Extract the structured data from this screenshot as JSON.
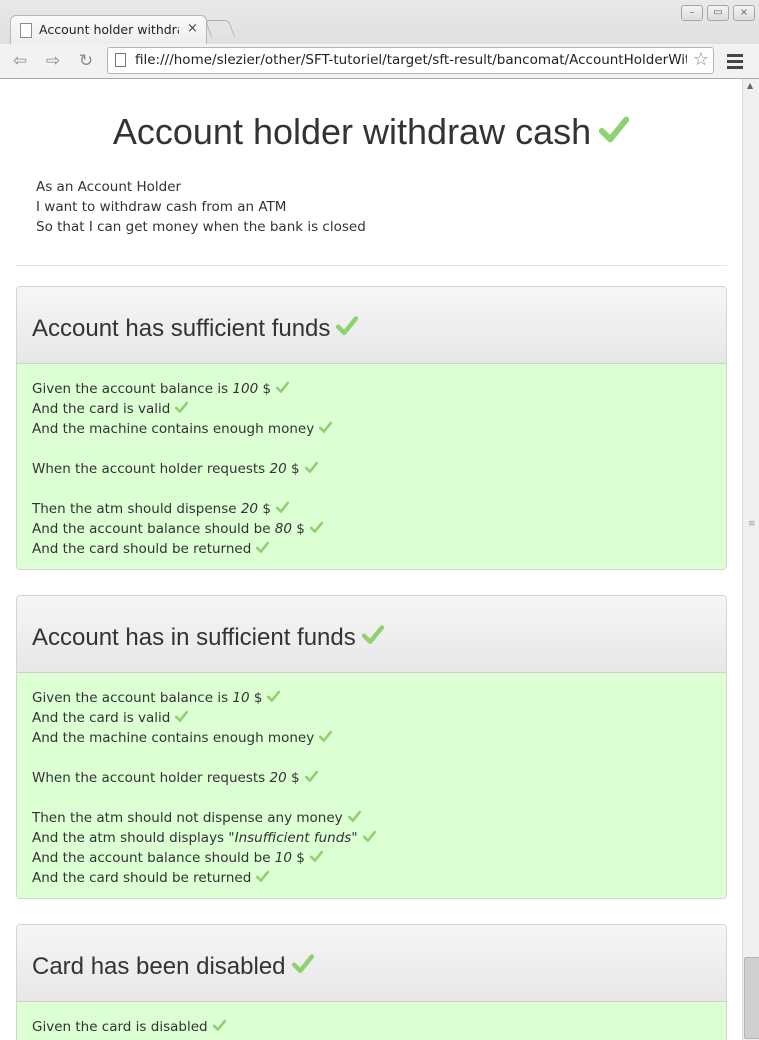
{
  "browser": {
    "tab_title": "Account holder withdraw",
    "tab_close": "×",
    "url": "file:///home/slezier/other/SFT-tutoriel/target/sft-result/bancomat/AccountHolderWithdrawCash.html",
    "window_minimize": "–",
    "window_maximize": "▭",
    "window_close": "×"
  },
  "feature": {
    "title": "Account holder withdraw cash",
    "story": [
      "As an Account Holder",
      "I want to withdraw cash from an ATM",
      "So that I can get money when the bank is closed"
    ]
  },
  "scenarios": [
    {
      "title": "Account has sufficient funds",
      "steps": [
        {
          "before": "Given the account balance is ",
          "param": "100",
          "after": " $"
        },
        {
          "before": "And the card is valid",
          "param": "",
          "after": ""
        },
        {
          "before": "And the machine contains enough money",
          "param": "",
          "after": ""
        },
        {
          "before": "When the account holder requests ",
          "param": "20",
          "after": " $"
        },
        {
          "before": "Then the atm should dispense ",
          "param": "20",
          "after": " $"
        },
        {
          "before": "And the account balance should be ",
          "param": "80",
          "after": " $"
        },
        {
          "before": "And the card should be returned",
          "param": "",
          "after": ""
        }
      ]
    },
    {
      "title": "Account has in sufficient funds",
      "steps": [
        {
          "before": "Given the account balance is ",
          "param": "10",
          "after": " $"
        },
        {
          "before": "And the card is valid",
          "param": "",
          "after": ""
        },
        {
          "before": "And the machine contains enough money",
          "param": "",
          "after": ""
        },
        {
          "before": "When the account holder requests ",
          "param": "20",
          "after": " $"
        },
        {
          "before": "Then the atm should not dispense any money",
          "param": "",
          "after": ""
        },
        {
          "before": "And the atm should displays \"",
          "param": "Insufficient funds",
          "after": "\""
        },
        {
          "before": "And the account balance should be ",
          "param": "10",
          "after": " $"
        },
        {
          "before": "And the card should be returned",
          "param": "",
          "after": ""
        }
      ]
    },
    {
      "title": "Card has been disabled",
      "steps": [
        {
          "before": "Given the card is disabled",
          "param": "",
          "after": ""
        }
      ]
    }
  ],
  "colors": {
    "success_check": "#8fd16f",
    "scenario_body": "#dcffd3"
  },
  "icons": {
    "status": "check-icon"
  }
}
